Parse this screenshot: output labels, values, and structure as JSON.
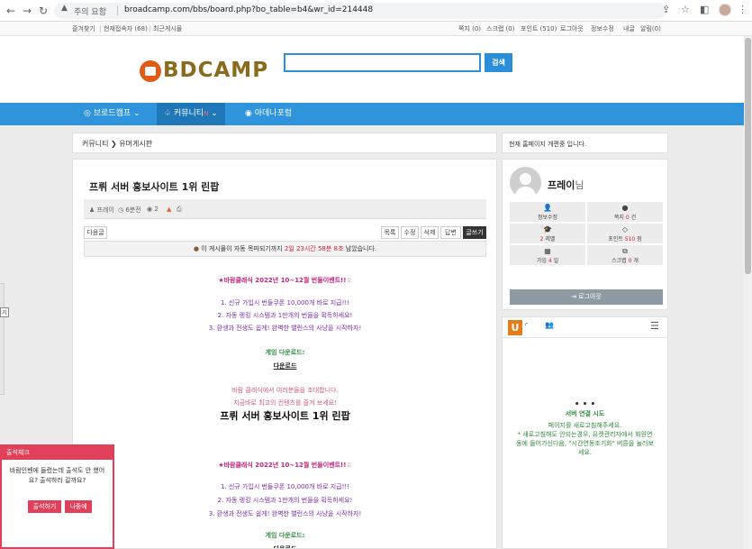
{
  "browser": {
    "security_label": "주의 요함",
    "url": "broadcamp.com/bbs/board.php?bo_table=b4&wr_id=214448"
  },
  "util_bar": {
    "left": [
      "즐겨찾기",
      "현재접속자 (68)",
      "최근게시물"
    ],
    "right": [
      "쪽지 (0)",
      "스크랩 (0)",
      "포인트 (510)",
      "로그아웃",
      "정보수정",
      "내글",
      "알림(0)"
    ]
  },
  "header": {
    "logo_text": "BDCAMP",
    "search_value": "",
    "search_button": "검색"
  },
  "main_nav": {
    "items": [
      {
        "icon": "◎",
        "label": "브로드캠프",
        "suffix": "⌄"
      },
      {
        "icon": "♤",
        "label": "커뮤니티",
        "badge": "N",
        "suffix": "⌄"
      },
      {
        "icon": "◉",
        "label": "아데나포럼",
        "suffix": ""
      }
    ]
  },
  "breadcrumb": {
    "section": "커뮤니티",
    "arrow": "❯",
    "page": "유머게시판"
  },
  "notice": {
    "text": "현재 홈페이지 개편중 입니다."
  },
  "post": {
    "title": "프뤼 서버 홍보사이트 1위 린팝",
    "author": "프레이",
    "time": "6분전",
    "views": "2",
    "buttons": {
      "next": "다음글",
      "list": "목록",
      "edit": "수정",
      "delete": "삭제",
      "reply": "답변",
      "write": "글쓰기"
    },
    "auto_delete": {
      "prefix": "이 게시물이 자동 목파되기까지",
      "remaining": "2일 23시간 58분 8초",
      "suffix": "남았습니다."
    },
    "body": {
      "event_title": "★바람클래식 2022년 10~12월 번들이벤트!!☆",
      "line1": "1. 신규 가입시 번들쿠폰 10,000개 바로 지급!!!",
      "line2": "2. 자동 렝킹 시스템과 1만개의 번들을 획득하세요!",
      "line3": "3. 환생과 전생도 쉽게! 완벽한 밸런스의 사냥을 시작하자!",
      "download_heading": "게임 다운로드:",
      "download_link": "다운로드",
      "invite1": "바람 클래식에서 여러분들을 초대합니다.",
      "invite2": "지금바로 최고의 컨텐츠를 즐겨 보세요!",
      "big_title": "프뤼 서버 홍보사이트 1위 린팝"
    }
  },
  "profile": {
    "name": "프레이",
    "suffix": "님",
    "cells": [
      {
        "icon": "👤",
        "label": "정보수정",
        "value": "",
        "unit": ""
      },
      {
        "icon": "●",
        "label": "쪽지",
        "value": "0",
        "unit": "건"
      },
      {
        "icon": "🎓",
        "label": "",
        "value": "2",
        "unit": "레벨"
      },
      {
        "icon": "◇",
        "label": "포인트",
        "value": "510",
        "unit": "점"
      },
      {
        "icon": "▦",
        "label": "가입",
        "value": "4",
        "unit": "일"
      },
      {
        "icon": "⧉",
        "label": "스크랩",
        "value": "0",
        "unit": "개"
      }
    ],
    "logout": "로그아웃"
  },
  "chat": {
    "logo": "U",
    "dots": "• • •",
    "status": "서버 연결 시도",
    "msg1": "페이지를 새로고침해주세요.",
    "msg2": "* 새로고침해도 안되는경우, 유켓관리자에서 회원연",
    "msg3": "동에 들어가신다음, \"시간연동조기화\" 버튼을 눌러보",
    "msg4": "세요."
  },
  "left_tag": "기",
  "attendance": {
    "header": "출석체크",
    "msg": "바람인벤에 들렸는데 출석도 안 했어요? 출석하러 갈까요?",
    "go": "출석하기",
    "later": "나중에"
  },
  "colors": {
    "nav_blue": "#2f94dc",
    "accent_red": "#e0405a",
    "logo_orange": "#e25b16"
  }
}
